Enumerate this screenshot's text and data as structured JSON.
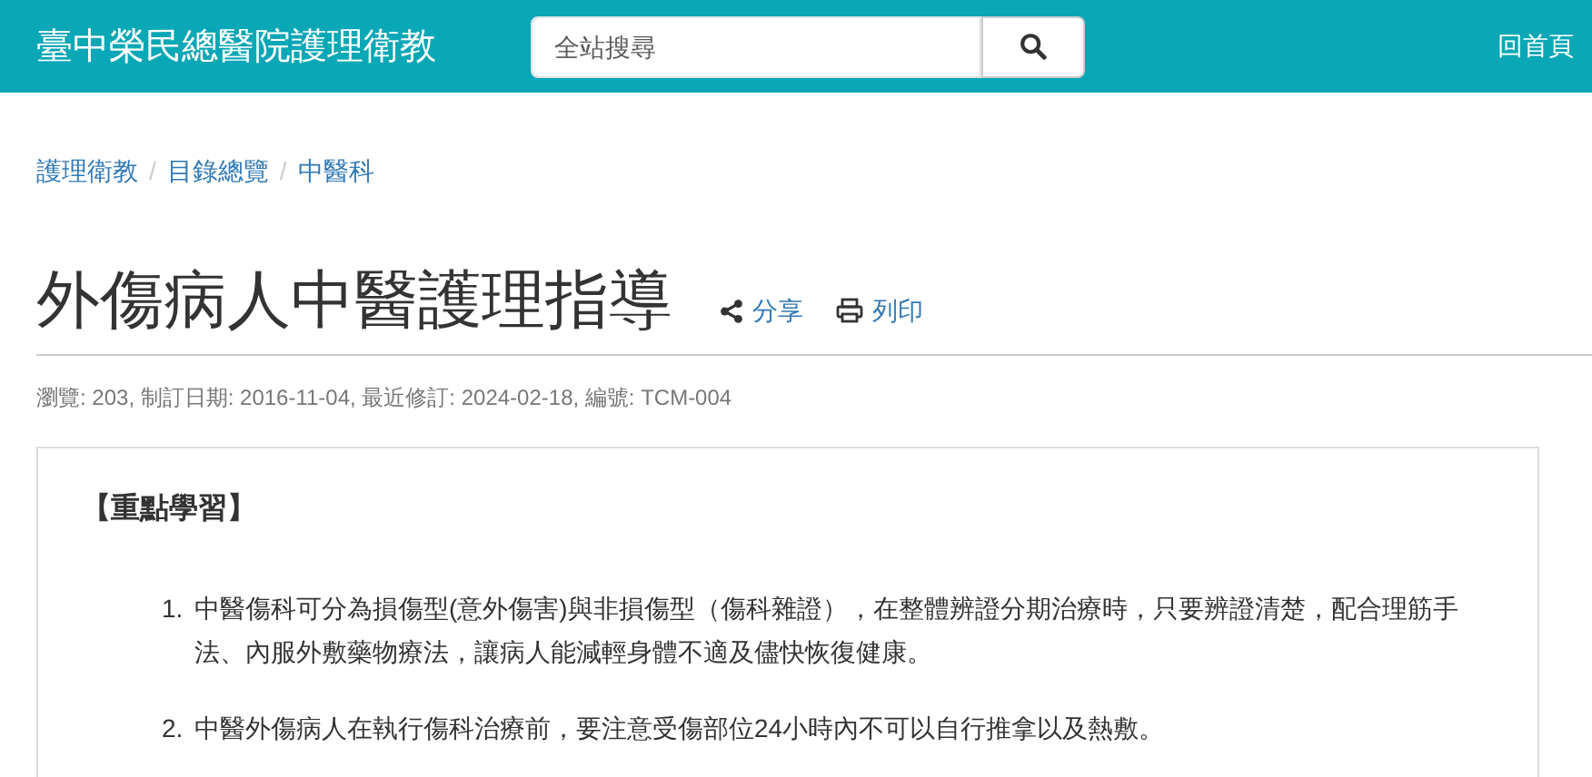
{
  "site_title": "臺中榮民總醫院護理衛教",
  "search": {
    "placeholder": "全站搜尋"
  },
  "home_link": "回首頁",
  "breadcrumb_separator": "/",
  "breadcrumb": [
    {
      "label": "護理衛教"
    },
    {
      "label": "目錄總覽"
    },
    {
      "label": "中醫科"
    }
  ],
  "article": {
    "title": "外傷病人中醫護理指導",
    "actions": [
      {
        "kind": "share",
        "label": "分享"
      },
      {
        "kind": "print",
        "label": "列印"
      }
    ],
    "meta": "瀏覽: 203, 制訂日期: 2016-11-04, 最近修訂: 2024-02-18, 編號: TCM-004",
    "section_heading": "【重點學習】",
    "items": [
      {
        "number": "1.",
        "text": "中醫傷科可分為損傷型(意外傷害)與非損傷型（傷科雜證），在整體辨證分期治療時，只要辨證清楚，配合理筋手法、內服外敷藥物療法，讓病人能減輕身體不適及儘快恢復健康。"
      },
      {
        "number": "2.",
        "text": "中醫外傷病人在執行傷科治療前，要注意受傷部位24小時內不可以自行推拿以及熱敷。"
      }
    ]
  }
}
